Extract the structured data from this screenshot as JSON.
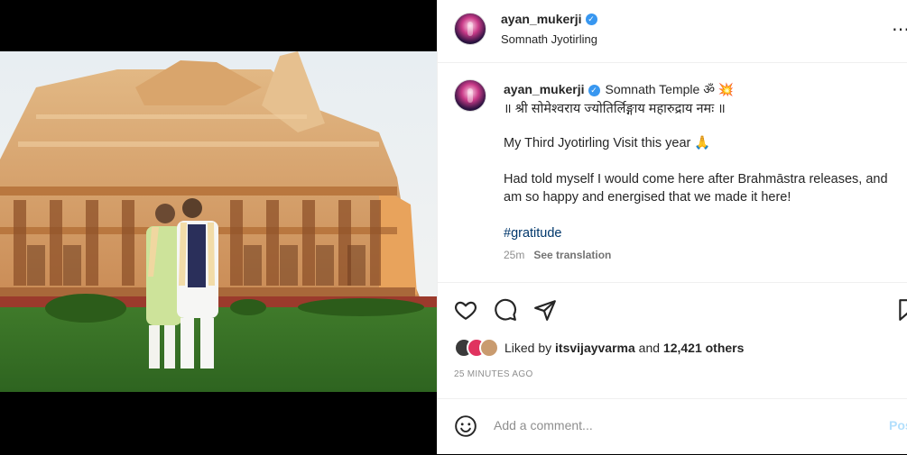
{
  "header": {
    "username": "ayan_mukerji",
    "location": "Somnath Jyotirling",
    "more_icon": "ellipsis-icon"
  },
  "caption": {
    "username": "ayan_mukerji",
    "location_text": "Somnath Temple ॐ 💥",
    "sanskrit": "॥ श्री सोमेश्वराय ज्योतिर्लिङ्गाय महारुद्राय नमः ॥",
    "line2": "My Third Jyotirling Visit this year 🙏",
    "line3": "Had told myself I would come here after Brahmāstra releases, and am so happy and energised that we made it here!",
    "hashtag": "#gratitude",
    "age": "25m",
    "see_translation": "See translation"
  },
  "likes": {
    "prefix": "Liked by",
    "user": "itsvijayvarma",
    "conj": "and",
    "others": "12,421 others"
  },
  "timestamp": "25 MINUTES AGO",
  "comment": {
    "placeholder": "Add a comment...",
    "post_label": "Pos"
  },
  "colors": {
    "link": "#00376b",
    "verified": "#3897f0",
    "post_disabled": "#b2dffc",
    "muted": "#8e8e8e"
  }
}
